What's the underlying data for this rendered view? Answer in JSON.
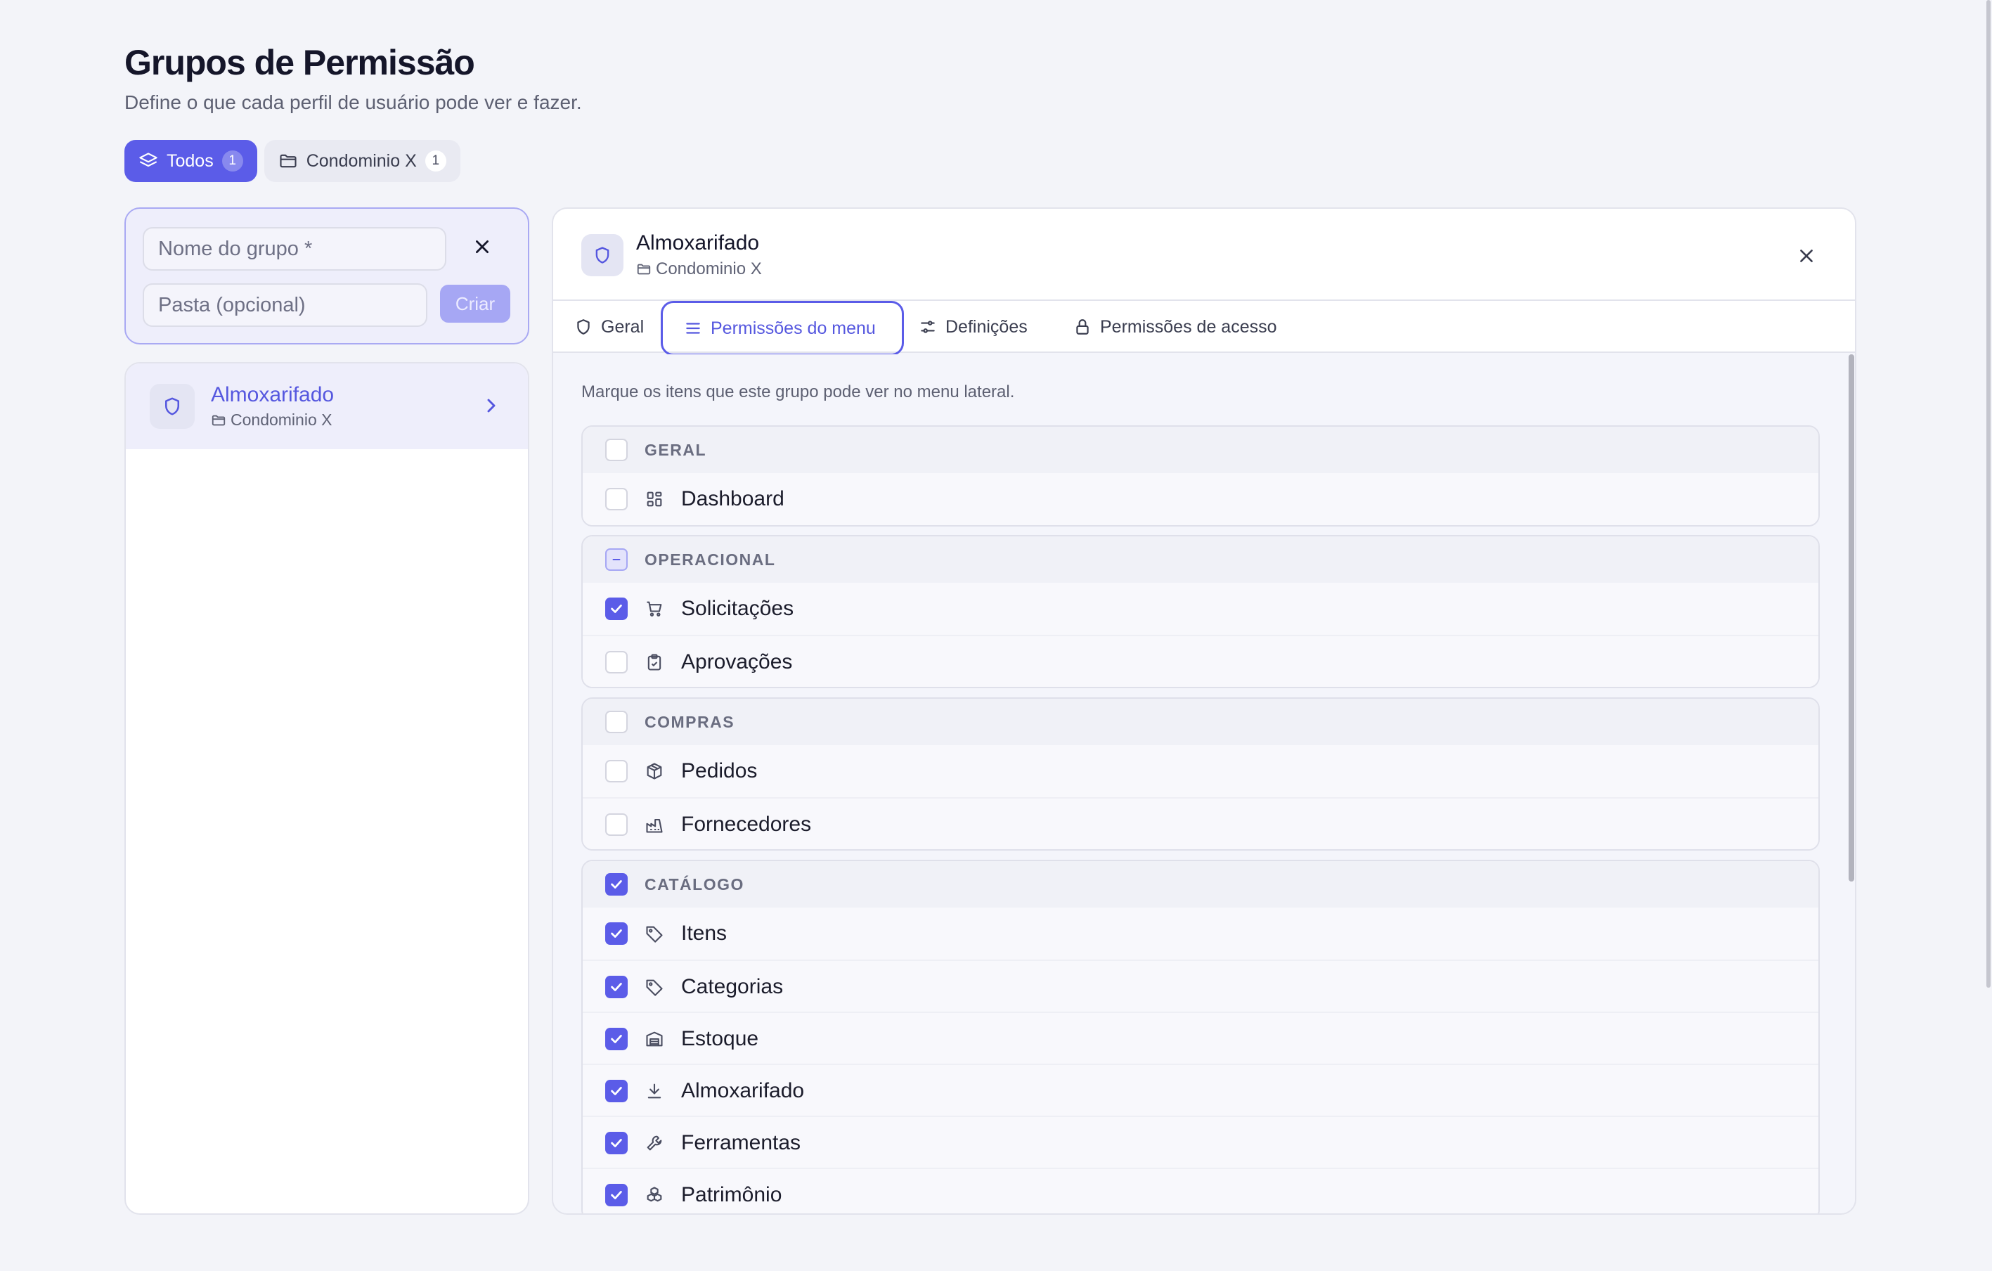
{
  "header": {
    "title": "Grupos de Permissão",
    "subtitle": "Define o que cada perfil de usuário pode ver e fazer."
  },
  "filters": [
    {
      "label": "Todos",
      "count": "1",
      "icon": "layers-icon",
      "active": true
    },
    {
      "label": "Condominio X",
      "count": "1",
      "icon": "folder-icon",
      "active": false
    }
  ],
  "create_form": {
    "name_placeholder": "Nome do grupo *",
    "folder_placeholder": "Pasta (opcional)",
    "create_label": "Criar"
  },
  "groups": [
    {
      "name": "Almoxarifado",
      "folder": "Condominio X"
    }
  ],
  "detail": {
    "title": "Almoxarifado",
    "folder": "Condominio X",
    "tabs": [
      {
        "label": "Geral",
        "icon": "shield-icon"
      },
      {
        "label": "Permissões do menu",
        "icon": "menu-icon",
        "active": true
      },
      {
        "label": "Definições",
        "icon": "sliders-icon"
      },
      {
        "label": "Permissões de acesso",
        "icon": "lock-icon"
      }
    ],
    "hint": "Marque os itens que este grupo pode ver no menu lateral.",
    "sections": [
      {
        "title": "GERAL",
        "state": "unchecked",
        "items": [
          {
            "label": "Dashboard",
            "icon": "dashboard-icon",
            "checked": false
          }
        ]
      },
      {
        "title": "OPERACIONAL",
        "state": "partial",
        "items": [
          {
            "label": "Solicitações",
            "icon": "cart-icon",
            "checked": true
          },
          {
            "label": "Aprovações",
            "icon": "clipboard-check-icon",
            "checked": false
          }
        ]
      },
      {
        "title": "COMPRAS",
        "state": "unchecked",
        "items": [
          {
            "label": "Pedidos",
            "icon": "package-icon",
            "checked": false
          },
          {
            "label": "Fornecedores",
            "icon": "factory-icon",
            "checked": false
          }
        ]
      },
      {
        "title": "CATÁLOGO",
        "state": "checked",
        "items": [
          {
            "label": "Itens",
            "icon": "tag-icon",
            "checked": true
          },
          {
            "label": "Categorias",
            "icon": "tag-icon",
            "checked": true
          },
          {
            "label": "Estoque",
            "icon": "warehouse-icon",
            "checked": true
          },
          {
            "label": "Almoxarifado",
            "icon": "download-icon",
            "checked": true
          },
          {
            "label": "Ferramentas",
            "icon": "wrench-icon",
            "checked": true
          },
          {
            "label": "Patrimônio",
            "icon": "boxes-icon",
            "checked": true
          }
        ]
      }
    ]
  },
  "colors": {
    "accent": "#5b5ce8",
    "accent_soft": "#eeeefb",
    "background": "#f3f4f9"
  }
}
